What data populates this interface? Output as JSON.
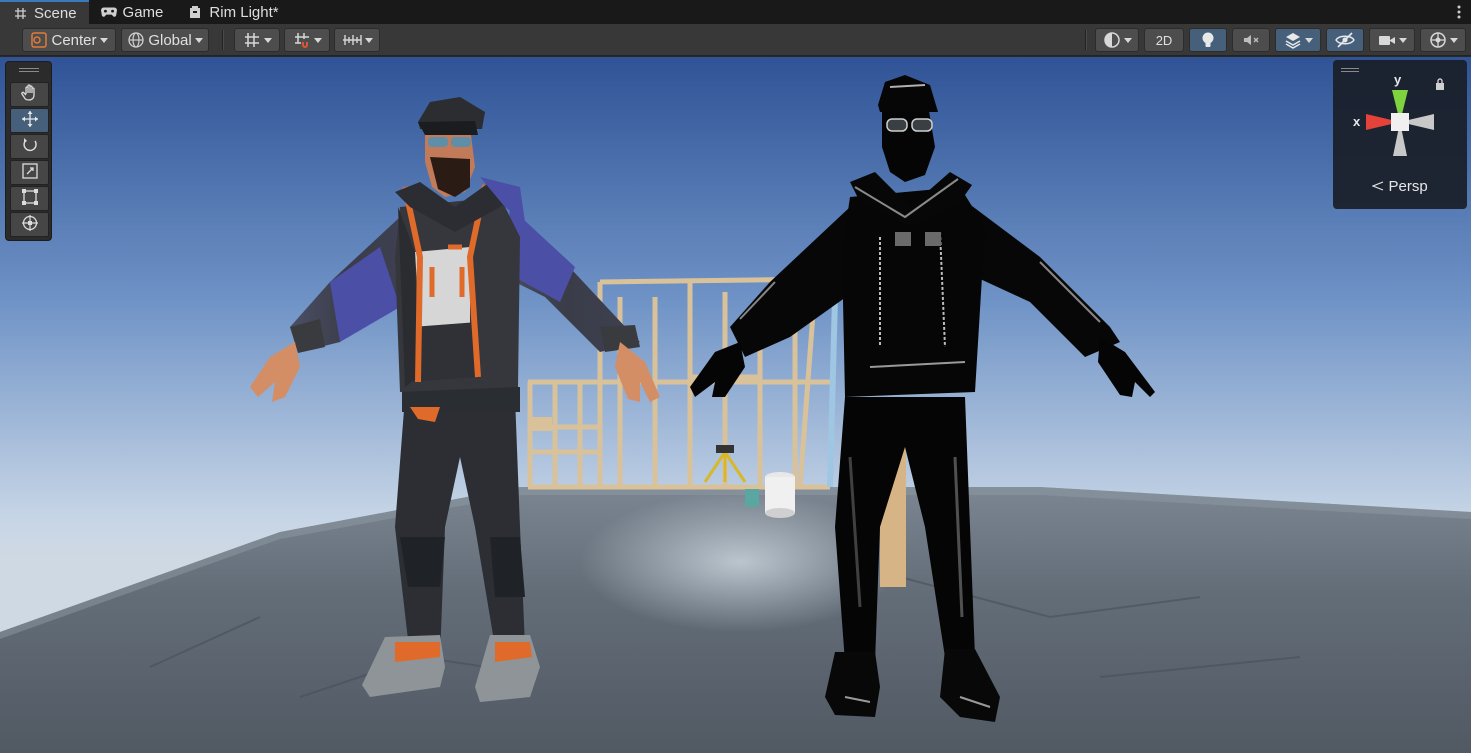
{
  "tabs": [
    {
      "label": "Scene",
      "icon": "hash-icon",
      "active": true
    },
    {
      "label": "Game",
      "icon": "gamepad-icon",
      "active": false
    },
    {
      "label": "Rim Light*",
      "icon": "file-icon",
      "active": false
    }
  ],
  "toolbar": {
    "pivot_label": "Center",
    "space_label": "Global",
    "mode_2d_label": "2D"
  },
  "gizmo": {
    "y_label": "y",
    "x_label": "x",
    "projection_label": "Persp"
  },
  "colors": {
    "accent": "#3a79bb",
    "active_button": "#46607c",
    "toolbar_bg": "#383838",
    "tab_bg": "#191919",
    "sky_top": "#2f5396",
    "sky_horizon": "#c6d5e6",
    "ground": "#5f6872"
  }
}
